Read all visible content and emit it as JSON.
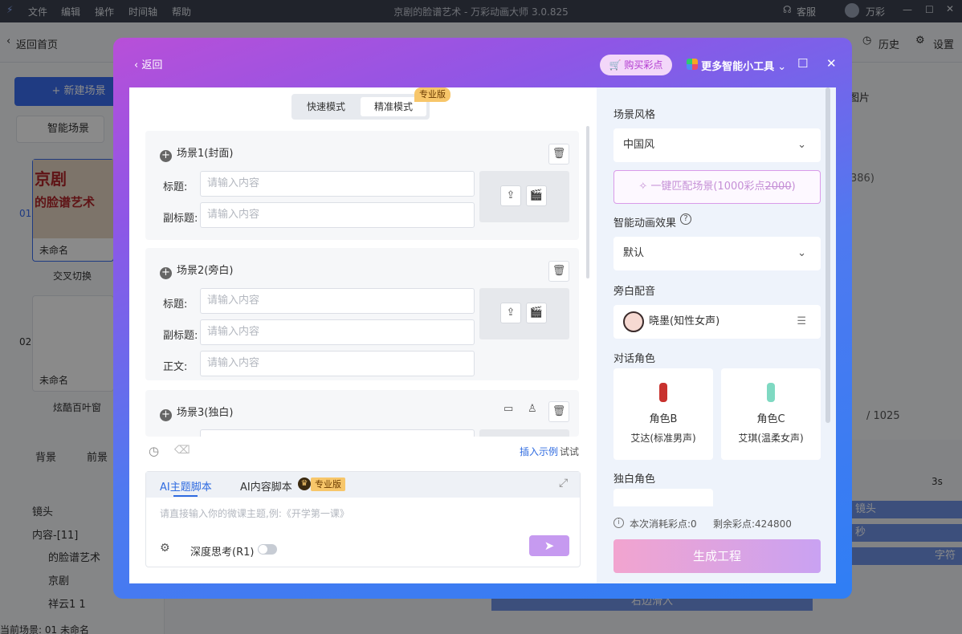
{
  "app": {
    "title": "京剧的脸谱艺术 - 万彩动画大师 3.0.825",
    "menu": [
      "文件",
      "编辑",
      "操作",
      "时间轴",
      "帮助"
    ],
    "support": "客服",
    "user": "万彩"
  },
  "background": {
    "back_home": "返回首页",
    "new_scene": "+ 新建场景",
    "smart_scene": "智能场景",
    "history": "历史",
    "settings": "设置",
    "scene1_num": "01",
    "scene1_name": "未命名",
    "scene1_thumb_text1": "京剧",
    "scene1_thumb_text2": "的脸谱艺术",
    "transition1": "交叉切换",
    "scene2_num": "02",
    "scene2_name": "未命名",
    "transition2": "炫酷百叶窗",
    "bg_btn": "背景",
    "fg_btn": "前景",
    "layer_camera": "镜头",
    "layer_content": "内容-[11]",
    "layer_items": [
      "的脸谱艺术",
      "京剧",
      "祥云1 1"
    ],
    "status": "当前场景: 01   未命名",
    "right_tab": "图片",
    "right_count": "386)",
    "page_counter": "/ 1025",
    "time_3s": "3s",
    "track_camera": "镜头",
    "track_seconds": "秒",
    "track_text": "字符",
    "track_right_in": "右边滑入"
  },
  "dialog": {
    "back": "返回",
    "buy_points": "购买彩点",
    "more_tools": "更多智能小工具",
    "mode_fast": "快速模式",
    "mode_precise": "精准模式",
    "pro_badge": "专业版",
    "scenes": [
      {
        "title": "场景1(封面)",
        "fields": [
          {
            "label": "标题:",
            "placeholder": "请输入内容"
          },
          {
            "label": "副标题:",
            "placeholder": "请输入内容"
          }
        ]
      },
      {
        "title": "场景2(旁白)",
        "fields": [
          {
            "label": "标题:",
            "placeholder": "请输入内容"
          },
          {
            "label": "副标题:",
            "placeholder": "请输入内容"
          },
          {
            "label": "正文:",
            "placeholder": "请输入内容"
          }
        ]
      },
      {
        "title": "场景3(独白)"
      }
    ],
    "insert_example": "插入示例",
    "try_it": "试试",
    "ai_tab_theme": "AI主题脚本",
    "ai_tab_content": "AI内容脚本",
    "ai_pro_badge": "专业版",
    "ai_placeholder": "请直接输入你的微课主题,例:《开学第一课》",
    "deep_think": "深度思考(R1)",
    "right": {
      "scene_style_label": "场景风格",
      "scene_style_value": "中国风",
      "match_btn_text": "一键匹配场景(1000彩点",
      "match_btn_strike": "2000",
      "match_btn_end": ")",
      "anim_label": "智能动画效果",
      "anim_value": "默认",
      "narration_label": "旁白配音",
      "narration_voice": "晓墨(知性女声)",
      "dialogue_label": "对话角色",
      "roles": [
        {
          "name": "角色B",
          "voice": "艾达(标准男声)"
        },
        {
          "name": "角色C",
          "voice": "艾琪(温柔女声)"
        }
      ],
      "monologue_label": "独白角色",
      "points_consume": "本次消耗彩点:0",
      "points_remain": "剩余彩点:424800",
      "generate": "生成工程"
    }
  }
}
